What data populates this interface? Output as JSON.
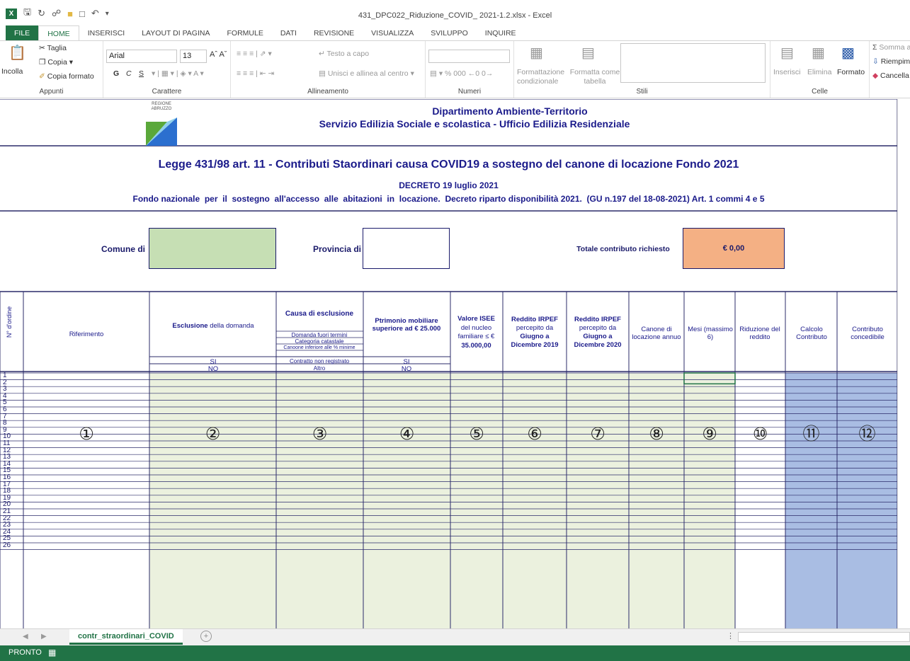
{
  "window": {
    "title": "431_DPC022_Riduzione_COVID_ 2021-1.2.xlsx - Excel",
    "app_icon": "excel-icon"
  },
  "tabs": [
    "FILE",
    "HOME",
    "INSERISCI",
    "LAYOUT DI PAGINA",
    "FORMULE",
    "DATI",
    "REVISIONE",
    "VISUALIZZA",
    "SVILUPPO",
    "INQUIRE"
  ],
  "ribbon": {
    "clipboard": {
      "paste": "Incolla",
      "cut": "Taglia",
      "copy": "Copia",
      "format_painter": "Copia formato",
      "group": "Appunti"
    },
    "font": {
      "name": "Arial",
      "size": "13",
      "bold": "G",
      "italic": "C",
      "underline": "S",
      "group": "Carattere"
    },
    "alignment": {
      "wrap": "Testo a capo",
      "merge": "Unisci e allinea al centro",
      "group": "Allineamento"
    },
    "number": {
      "group": "Numeri",
      "percent": "%",
      "thousands": "000"
    },
    "styles": {
      "conditional": "Formattazione condizionale",
      "format_table": "Formatta come tabella",
      "group": "Stili"
    },
    "cells": {
      "insert": "Inserisci",
      "delete": "Elimina",
      "format": "Formato",
      "group": "Celle"
    },
    "editing": {
      "sum": "Somma a",
      "fill": "Riempim",
      "clear": "Cancella"
    }
  },
  "sheet": {
    "logo_text": "REGIONE ABRUZZO",
    "dept": "Dipartimento Ambiente-Territorio",
    "service": "Servizio Edilizia Sociale e scolastica - Ufficio Edilizia Residenziale",
    "law": "Legge 431/98 art. 11 - Contributi Staordinari causa COVID19 a sostegno del canone di locazione Fondo 2021",
    "decree": "DECRETO 19 luglio 2021",
    "fund": "Fondo nazionale  per  il  sostegno  all'accesso  alle  abitazioni  in  locazione.  Decreto riparto disponibilità 2021.  (GU n.197 del 18-08-2021) Art. 1 commi 4 e 5",
    "comune_label": "Comune di",
    "provincia_label": "Provincia di",
    "total_label": "Totale contributo richiesto",
    "total_value": "€ 0,00",
    "headers": {
      "ordine": "N° d'ordine",
      "riferimento": "Riferimento",
      "esclusione_bold": "Esclusione",
      "esclusione_rest": " della  domanda",
      "causa": "Causa di esclusione",
      "causa_items": [
        "Domanda fuori termini",
        "Categoria catastale",
        "Canoone inferiore alle % minime",
        "Contratto non registrato",
        "Altro"
      ],
      "patrimonio": "Ptrimonio mobiliare superiore ad € 25.000",
      "isee_bold": "Valore ISEE",
      "isee_rest1": "del nucleo",
      "isee_rest2": "familiare  ≤ €",
      "isee_rest3": "35.000,00",
      "r2019_1": "Reddito IRPEF",
      "r2019_2": "percepito da",
      "r2019_3": "Giugno a",
      "r2019_4": "Dicembre 2019",
      "r2020_1": "Reddito IRPEF",
      "r2020_2": "percepito da",
      "r2020_3": "Giugno a",
      "r2020_4": "Dicembre 2020",
      "canone": "Canone di locazione annuo",
      "mesi": "Mesi (massimo 6)",
      "riduzione": "Riduzione del reddito",
      "calcolo": "Calcolo Contributo",
      "contributo": "Contributo concedibile",
      "si": "SI",
      "no": "NO"
    },
    "circled": [
      "①",
      "②",
      "③",
      "④",
      "⑤",
      "⑥",
      "⑦",
      "⑧",
      "⑨",
      "⑩",
      "⑪",
      "⑫"
    ],
    "row_numbers": [
      "1",
      "2",
      "3",
      "4",
      "5",
      "6",
      "7",
      "8",
      "9",
      "10",
      "11",
      "12",
      "13",
      "14",
      "15",
      "16",
      "17",
      "18",
      "19",
      "20",
      "21",
      "22",
      "23",
      "24",
      "25",
      "26"
    ]
  },
  "sheet_tab": "contr_straordinari_COVID",
  "status": "PRONTO",
  "colors": {
    "green": "#217346",
    "cell_green": "#ebf1de",
    "input_green": "#c6dfb4",
    "blue": "#a9bde3",
    "orange": "#f4b084",
    "grid": "#2b2b6a"
  }
}
